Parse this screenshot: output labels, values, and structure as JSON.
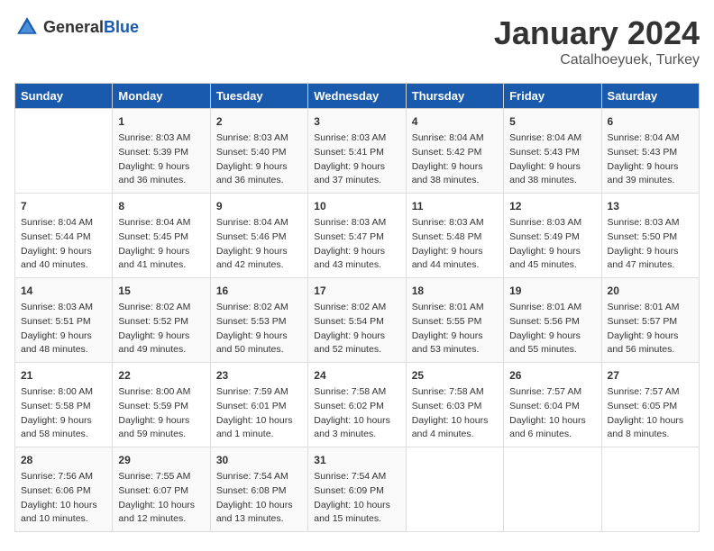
{
  "logo": {
    "general": "General",
    "blue": "Blue"
  },
  "title": {
    "month": "January 2024",
    "location": "Catalhoeyuek, Turkey"
  },
  "headers": [
    "Sunday",
    "Monday",
    "Tuesday",
    "Wednesday",
    "Thursday",
    "Friday",
    "Saturday"
  ],
  "weeks": [
    [
      {
        "day": "",
        "sunrise": "",
        "sunset": "",
        "daylight": ""
      },
      {
        "day": "1",
        "sunrise": "Sunrise: 8:03 AM",
        "sunset": "Sunset: 5:39 PM",
        "daylight": "Daylight: 9 hours and 36 minutes."
      },
      {
        "day": "2",
        "sunrise": "Sunrise: 8:03 AM",
        "sunset": "Sunset: 5:40 PM",
        "daylight": "Daylight: 9 hours and 36 minutes."
      },
      {
        "day": "3",
        "sunrise": "Sunrise: 8:03 AM",
        "sunset": "Sunset: 5:41 PM",
        "daylight": "Daylight: 9 hours and 37 minutes."
      },
      {
        "day": "4",
        "sunrise": "Sunrise: 8:04 AM",
        "sunset": "Sunset: 5:42 PM",
        "daylight": "Daylight: 9 hours and 38 minutes."
      },
      {
        "day": "5",
        "sunrise": "Sunrise: 8:04 AM",
        "sunset": "Sunset: 5:43 PM",
        "daylight": "Daylight: 9 hours and 38 minutes."
      },
      {
        "day": "6",
        "sunrise": "Sunrise: 8:04 AM",
        "sunset": "Sunset: 5:43 PM",
        "daylight": "Daylight: 9 hours and 39 minutes."
      }
    ],
    [
      {
        "day": "7",
        "sunrise": "Sunrise: 8:04 AM",
        "sunset": "Sunset: 5:44 PM",
        "daylight": "Daylight: 9 hours and 40 minutes."
      },
      {
        "day": "8",
        "sunrise": "Sunrise: 8:04 AM",
        "sunset": "Sunset: 5:45 PM",
        "daylight": "Daylight: 9 hours and 41 minutes."
      },
      {
        "day": "9",
        "sunrise": "Sunrise: 8:04 AM",
        "sunset": "Sunset: 5:46 PM",
        "daylight": "Daylight: 9 hours and 42 minutes."
      },
      {
        "day": "10",
        "sunrise": "Sunrise: 8:03 AM",
        "sunset": "Sunset: 5:47 PM",
        "daylight": "Daylight: 9 hours and 43 minutes."
      },
      {
        "day": "11",
        "sunrise": "Sunrise: 8:03 AM",
        "sunset": "Sunset: 5:48 PM",
        "daylight": "Daylight: 9 hours and 44 minutes."
      },
      {
        "day": "12",
        "sunrise": "Sunrise: 8:03 AM",
        "sunset": "Sunset: 5:49 PM",
        "daylight": "Daylight: 9 hours and 45 minutes."
      },
      {
        "day": "13",
        "sunrise": "Sunrise: 8:03 AM",
        "sunset": "Sunset: 5:50 PM",
        "daylight": "Daylight: 9 hours and 47 minutes."
      }
    ],
    [
      {
        "day": "14",
        "sunrise": "Sunrise: 8:03 AM",
        "sunset": "Sunset: 5:51 PM",
        "daylight": "Daylight: 9 hours and 48 minutes."
      },
      {
        "day": "15",
        "sunrise": "Sunrise: 8:02 AM",
        "sunset": "Sunset: 5:52 PM",
        "daylight": "Daylight: 9 hours and 49 minutes."
      },
      {
        "day": "16",
        "sunrise": "Sunrise: 8:02 AM",
        "sunset": "Sunset: 5:53 PM",
        "daylight": "Daylight: 9 hours and 50 minutes."
      },
      {
        "day": "17",
        "sunrise": "Sunrise: 8:02 AM",
        "sunset": "Sunset: 5:54 PM",
        "daylight": "Daylight: 9 hours and 52 minutes."
      },
      {
        "day": "18",
        "sunrise": "Sunrise: 8:01 AM",
        "sunset": "Sunset: 5:55 PM",
        "daylight": "Daylight: 9 hours and 53 minutes."
      },
      {
        "day": "19",
        "sunrise": "Sunrise: 8:01 AM",
        "sunset": "Sunset: 5:56 PM",
        "daylight": "Daylight: 9 hours and 55 minutes."
      },
      {
        "day": "20",
        "sunrise": "Sunrise: 8:01 AM",
        "sunset": "Sunset: 5:57 PM",
        "daylight": "Daylight: 9 hours and 56 minutes."
      }
    ],
    [
      {
        "day": "21",
        "sunrise": "Sunrise: 8:00 AM",
        "sunset": "Sunset: 5:58 PM",
        "daylight": "Daylight: 9 hours and 58 minutes."
      },
      {
        "day": "22",
        "sunrise": "Sunrise: 8:00 AM",
        "sunset": "Sunset: 5:59 PM",
        "daylight": "Daylight: 9 hours and 59 minutes."
      },
      {
        "day": "23",
        "sunrise": "Sunrise: 7:59 AM",
        "sunset": "Sunset: 6:01 PM",
        "daylight": "Daylight: 10 hours and 1 minute."
      },
      {
        "day": "24",
        "sunrise": "Sunrise: 7:58 AM",
        "sunset": "Sunset: 6:02 PM",
        "daylight": "Daylight: 10 hours and 3 minutes."
      },
      {
        "day": "25",
        "sunrise": "Sunrise: 7:58 AM",
        "sunset": "Sunset: 6:03 PM",
        "daylight": "Daylight: 10 hours and 4 minutes."
      },
      {
        "day": "26",
        "sunrise": "Sunrise: 7:57 AM",
        "sunset": "Sunset: 6:04 PM",
        "daylight": "Daylight: 10 hours and 6 minutes."
      },
      {
        "day": "27",
        "sunrise": "Sunrise: 7:57 AM",
        "sunset": "Sunset: 6:05 PM",
        "daylight": "Daylight: 10 hours and 8 minutes."
      }
    ],
    [
      {
        "day": "28",
        "sunrise": "Sunrise: 7:56 AM",
        "sunset": "Sunset: 6:06 PM",
        "daylight": "Daylight: 10 hours and 10 minutes."
      },
      {
        "day": "29",
        "sunrise": "Sunrise: 7:55 AM",
        "sunset": "Sunset: 6:07 PM",
        "daylight": "Daylight: 10 hours and 12 minutes."
      },
      {
        "day": "30",
        "sunrise": "Sunrise: 7:54 AM",
        "sunset": "Sunset: 6:08 PM",
        "daylight": "Daylight: 10 hours and 13 minutes."
      },
      {
        "day": "31",
        "sunrise": "Sunrise: 7:54 AM",
        "sunset": "Sunset: 6:09 PM",
        "daylight": "Daylight: 10 hours and 15 minutes."
      },
      {
        "day": "",
        "sunrise": "",
        "sunset": "",
        "daylight": ""
      },
      {
        "day": "",
        "sunrise": "",
        "sunset": "",
        "daylight": ""
      },
      {
        "day": "",
        "sunrise": "",
        "sunset": "",
        "daylight": ""
      }
    ]
  ]
}
